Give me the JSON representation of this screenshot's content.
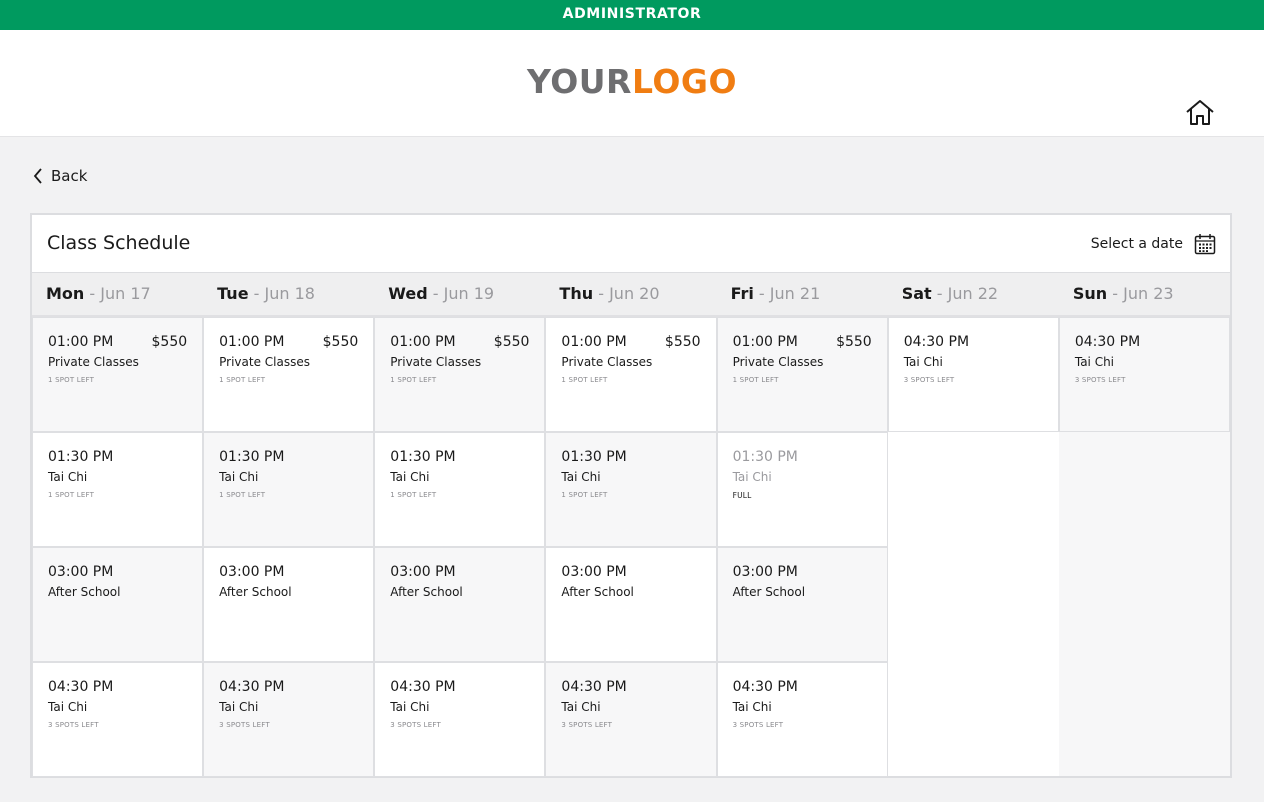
{
  "admin_bar": {
    "label": "ADMINISTRATOR"
  },
  "header": {
    "logo_part1": "YOUR",
    "logo_part2": "LOGO",
    "home_icon": "home-icon"
  },
  "nav": {
    "back_label": "Back"
  },
  "schedule": {
    "title": "Class Schedule",
    "select_date_label": "Select a date",
    "days": [
      {
        "name": "Mon",
        "date": "Jun 17"
      },
      {
        "name": "Tue",
        "date": "Jun 18"
      },
      {
        "name": "Wed",
        "date": "Jun 19"
      },
      {
        "name": "Thu",
        "date": "Jun 20"
      },
      {
        "name": "Fri",
        "date": "Jun 21"
      },
      {
        "name": "Sat",
        "date": "Jun 22"
      },
      {
        "name": "Sun",
        "date": "Jun 23"
      }
    ],
    "columns": [
      [
        {
          "time": "01:00 PM",
          "price": "$550",
          "name": "Private Classes",
          "spots": "1 SPOT LEFT"
        },
        {
          "time": "01:30 PM",
          "price": "",
          "name": "Tai Chi",
          "spots": "1 SPOT LEFT"
        },
        {
          "time": "03:00 PM",
          "price": "",
          "name": "After School",
          "spots": ""
        },
        {
          "time": "04:30 PM",
          "price": "",
          "name": "Tai Chi",
          "spots": "3 SPOTS LEFT"
        }
      ],
      [
        {
          "time": "01:00 PM",
          "price": "$550",
          "name": "Private Classes",
          "spots": "1 SPOT LEFT"
        },
        {
          "time": "01:30 PM",
          "price": "",
          "name": "Tai Chi",
          "spots": "1 SPOT LEFT"
        },
        {
          "time": "03:00 PM",
          "price": "",
          "name": "After School",
          "spots": ""
        },
        {
          "time": "04:30 PM",
          "price": "",
          "name": "Tai Chi",
          "spots": "3 SPOTS LEFT"
        }
      ],
      [
        {
          "time": "01:00 PM",
          "price": "$550",
          "name": "Private Classes",
          "spots": "1 SPOT LEFT"
        },
        {
          "time": "01:30 PM",
          "price": "",
          "name": "Tai Chi",
          "spots": "1 SPOT LEFT"
        },
        {
          "time": "03:00 PM",
          "price": "",
          "name": "After School",
          "spots": ""
        },
        {
          "time": "04:30 PM",
          "price": "",
          "name": "Tai Chi",
          "spots": "3 SPOTS LEFT"
        }
      ],
      [
        {
          "time": "01:00 PM",
          "price": "$550",
          "name": "Private Classes",
          "spots": "1 SPOT LEFT"
        },
        {
          "time": "01:30 PM",
          "price": "",
          "name": "Tai Chi",
          "spots": "1 SPOT LEFT"
        },
        {
          "time": "03:00 PM",
          "price": "",
          "name": "After School",
          "spots": ""
        },
        {
          "time": "04:30 PM",
          "price": "",
          "name": "Tai Chi",
          "spots": "3 SPOTS LEFT"
        }
      ],
      [
        {
          "time": "01:00 PM",
          "price": "$550",
          "name": "Private Classes",
          "spots": "1 SPOT LEFT"
        },
        {
          "time": "01:30 PM",
          "price": "",
          "name": "Tai Chi",
          "spots": "FULL",
          "full": true
        },
        {
          "time": "03:00 PM",
          "price": "",
          "name": "After School",
          "spots": ""
        },
        {
          "time": "04:30 PM",
          "price": "",
          "name": "Tai Chi",
          "spots": "3 SPOTS LEFT"
        }
      ],
      [
        {
          "time": "04:30 PM",
          "price": "",
          "name": "Tai Chi",
          "spots": "3 SPOTS LEFT"
        }
      ],
      [
        {
          "time": "04:30 PM",
          "price": "",
          "name": "Tai Chi",
          "spots": "3 SPOTS LEFT"
        }
      ]
    ]
  },
  "colors": {
    "brand_green": "#009a5f",
    "logo_gray": "#6e6e70",
    "logo_orange": "#f07d12"
  }
}
